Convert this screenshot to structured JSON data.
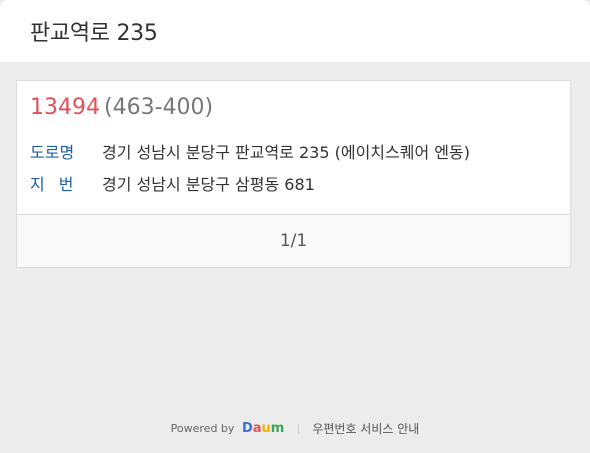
{
  "header": {
    "title": "판교역로 235"
  },
  "result": {
    "zip_code": "13494",
    "old_zip": "(463-400)",
    "road_label": "도로명",
    "road_address": "경기 성남시 분당구 판교역로 235 (에이치스퀘어 엔동)",
    "jibun_label": "지번",
    "jibun_address": "경기 성남시 분당구 삼평동 681"
  },
  "pager": {
    "text": "1/1"
  },
  "footer": {
    "powered_by": "Powered by",
    "logo": {
      "d1": "D",
      "a": "a",
      "u": "u",
      "m": "m"
    },
    "guide_link": "우편번호 서비스 안내"
  },
  "colors": {
    "zip": "#e2505a",
    "label": "#1f5fa8"
  }
}
